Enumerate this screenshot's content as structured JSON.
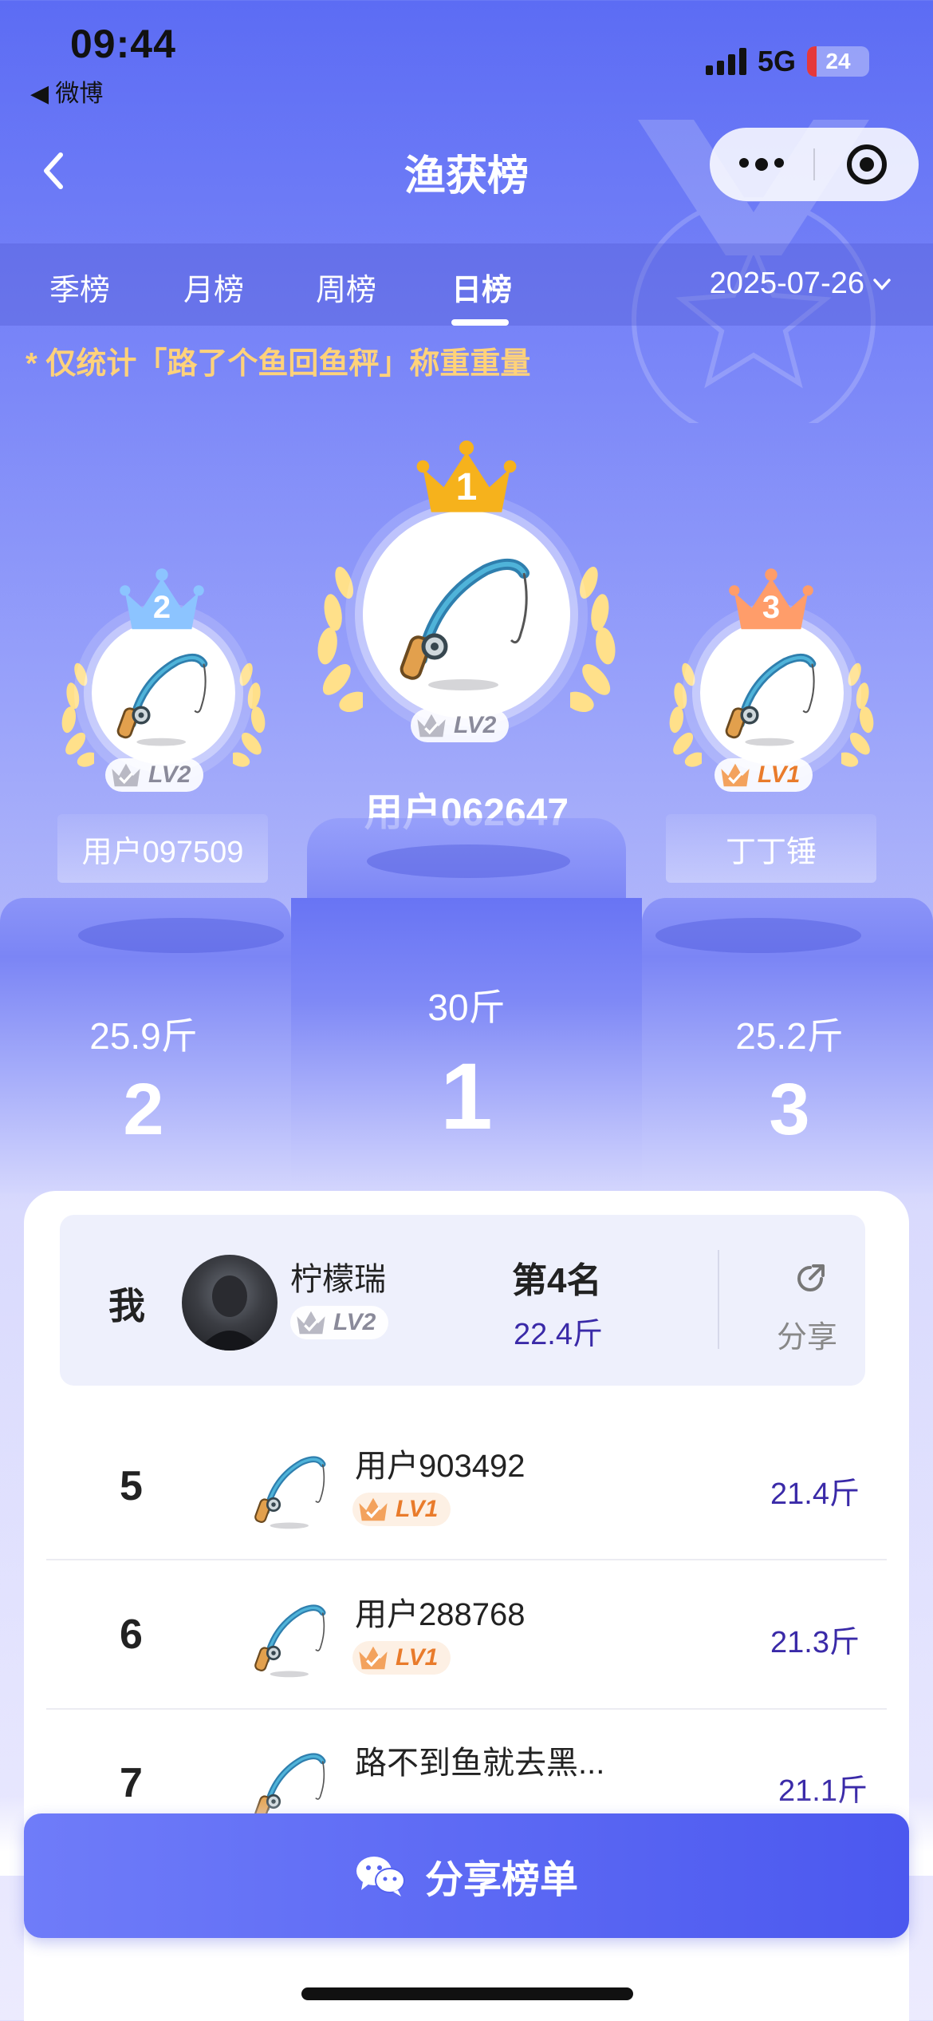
{
  "status_bar": {
    "time": "09:44",
    "back_app": "◀ 微博",
    "network": "5G",
    "battery": "24"
  },
  "nav": {
    "title": "渔获榜"
  },
  "tabs": [
    {
      "label": "季榜",
      "active": false
    },
    {
      "label": "月榜",
      "active": false
    },
    {
      "label": "周榜",
      "active": false
    },
    {
      "label": "日榜",
      "active": true
    }
  ],
  "date_picker": {
    "value": "2025-07-26"
  },
  "notice": "* 仅统计「路了个鱼回鱼秤」称重重量",
  "podium": {
    "first": {
      "crown": "1",
      "level": "LV2",
      "name": "用户062647",
      "weight": "30斤",
      "rank": "1"
    },
    "second": {
      "crown": "2",
      "level": "LV2",
      "name": "用户097509",
      "weight": "25.9斤",
      "rank": "2"
    },
    "third": {
      "crown": "3",
      "level": "LV1",
      "name": "丁丁锤",
      "weight": "25.2斤",
      "rank": "3"
    }
  },
  "me": {
    "label": "我",
    "name": "柠檬瑞",
    "level": "LV2",
    "rank": "第4名",
    "weight": "22.4斤",
    "share_label": "分享"
  },
  "list": [
    {
      "rank": "5",
      "name": "用户903492",
      "level": "LV1",
      "weight": "21.4斤"
    },
    {
      "rank": "6",
      "name": "用户288768",
      "level": "LV1",
      "weight": "21.3斤"
    },
    {
      "rank": "7",
      "name": "路不到鱼就去黑...",
      "level": "",
      "weight": "21.1斤"
    }
  ],
  "share_button": {
    "label": "分享榜单"
  },
  "colors": {
    "accent": "#5563f0",
    "weight_text": "#3a2aa8",
    "notice_text": "#ffd27a",
    "gold": "#f6b21c",
    "silver_crown": "#8cc4ff",
    "bronze_crown": "#ff9d6a"
  }
}
